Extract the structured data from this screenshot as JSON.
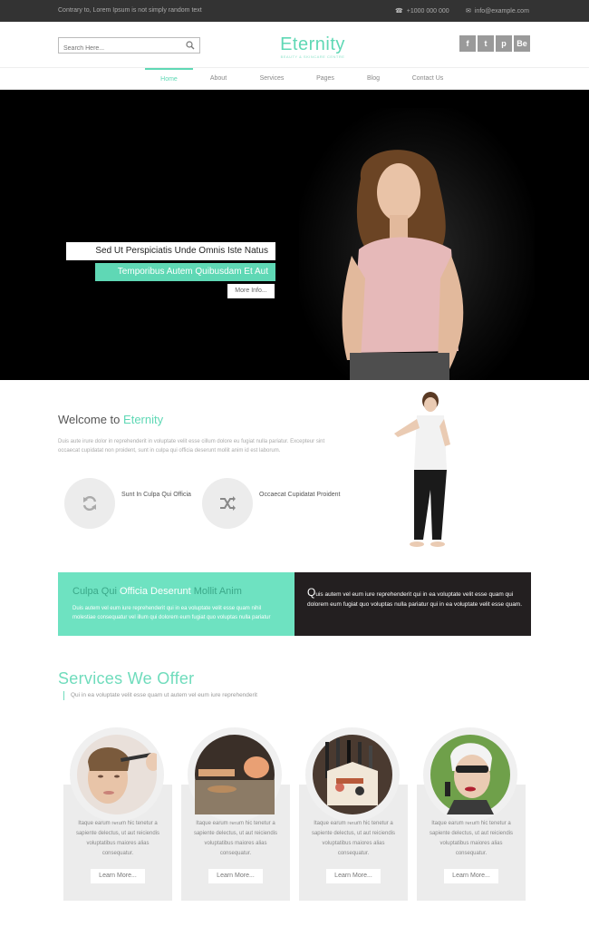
{
  "topbar": {
    "tagline": "Contrary to, Lorem Ipsum is not simply random text",
    "phone": "+1000 000 000",
    "email": "info@example.com"
  },
  "header": {
    "search_placeholder": "Search Here...",
    "logo": "Eternity",
    "logo_sub": "BEAUTY & SKINCARE CENTRE",
    "social": [
      "f",
      "t",
      "p",
      "Be"
    ]
  },
  "nav": {
    "items": [
      "Home",
      "About",
      "Services",
      "Pages",
      "Blog",
      "Contact Us"
    ],
    "active": "Home"
  },
  "hero": {
    "caption1": "Sed Ut Perspiciatis Unde Omnis Iste Natus",
    "caption2": "Temporibus Autem Quibusdam Et Aut",
    "button": "More Info..."
  },
  "welcome": {
    "title_prefix": "Welcome to",
    "title_accent": "Eternity",
    "text": "Duis aute irure dolor in reprehenderit in voluptate velit esse cillum dolore eu fugiat nulla pariatur. Excepteur sint occaecat cupidatat non proident, sunt in culpa qui officia deserunt mollit anim id est laborum.",
    "features": [
      {
        "icon": "refresh-icon",
        "label": "Sunt In Culpa Qui Officia"
      },
      {
        "icon": "shuffle-icon",
        "label": "Occaecat Cupidatat Proident"
      }
    ]
  },
  "banner": {
    "left_title_1": "Culpa Qui",
    "left_title_2": "Officia Deserunt",
    "left_title_3": "Mollit Anim",
    "left_text": "Duis autem vel eum iure reprehenderit qui in ea voluptate velit esse quam nihil molestiae consequatur vel illum qui dolorem eum fugiat quo voluptas nulla pariatur",
    "right_drop": "Q",
    "right_text": "uis autem vel eum iure reprehenderit qui in ea voluptate velit esse quam qui dolorem eum fugiat quo voluptas nulla pariatur qui in ea voluptate velit esse quam."
  },
  "services": {
    "title": "Services We Offer",
    "subtitle": "Qui in ea voluptate velit esse quam ut autem vel eum iure reprehenderit",
    "cards": [
      {
        "text": "Itaque earum rerum hic tenetur a sapiente delectus, ut aut reiciendis voluptatibus maiores alias consequatur.",
        "button": "Learn More..."
      },
      {
        "text": "Itaque earum rerum hic tenetur a sapiente delectus, ut aut reiciendis voluptatibus maiores alias consequatur.",
        "button": "Learn More..."
      },
      {
        "text": "Itaque earum rerum hic tenetur a sapiente delectus, ut aut reiciendis voluptatibus maiores alias consequatur.",
        "button": "Learn More..."
      },
      {
        "text": "Itaque earum rerum hic tenetur a sapiente delectus, ut aut reiciendis voluptatibus maiores alias consequatur.",
        "button": "Learn More..."
      }
    ]
  },
  "colors": {
    "accent": "#5fd8b5",
    "dark": "#231f20",
    "topbar": "#333333"
  }
}
